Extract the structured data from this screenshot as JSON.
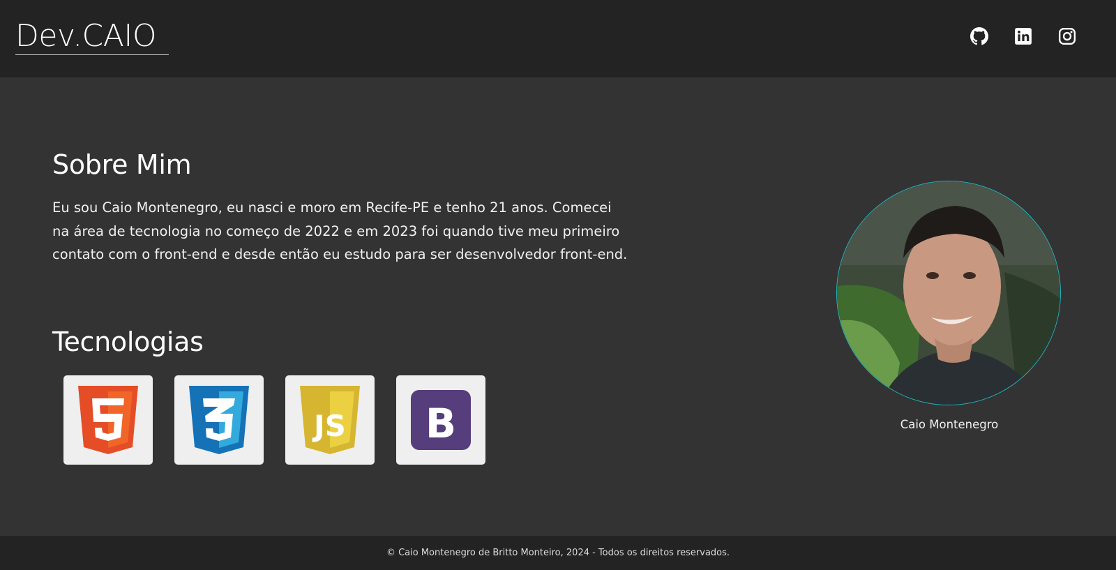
{
  "header": {
    "logo": "Dev.CAIO",
    "social": [
      {
        "icon": "github-icon"
      },
      {
        "icon": "linkedin-icon"
      },
      {
        "icon": "instagram-icon"
      }
    ]
  },
  "about": {
    "title": "Sobre Mim",
    "text": "Eu sou Caio Montenegro, eu nasci e moro em Recife-PE e tenho 21 anos. Comecei na área de tecnologia no começo de 2022 e em 2023 foi quando tive meu primeiro contato com o front-end e desde então eu estudo para ser desenvolvedor front-end."
  },
  "technologies": {
    "title": "Tecnologias",
    "items": [
      {
        "icon": "html5-icon",
        "color": "#e44d26"
      },
      {
        "icon": "css3-icon",
        "color": "#1572b6"
      },
      {
        "icon": "javascript-icon",
        "color": "#d6b531"
      },
      {
        "icon": "bootstrap-icon",
        "color": "#563d7c"
      }
    ]
  },
  "profile": {
    "caption": "Caio Montenegro",
    "accent": "#1fb5c2"
  },
  "footer": {
    "text": "© Caio Montenegro de Britto Monteiro, 2024 - Todos os direitos reservados."
  }
}
